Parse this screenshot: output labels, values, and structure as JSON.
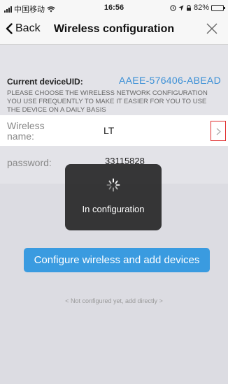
{
  "status_bar": {
    "carrier": "中国移动",
    "time": "16:56",
    "battery": "82%",
    "battery_level": 0.82
  },
  "nav": {
    "back_label": "Back",
    "title": "Wireless configuration"
  },
  "device": {
    "uid_label": "Current deviceUID:",
    "uid_value": "AAEE-576406-ABEAD",
    "description": "PLEASE CHOOSE THE WIRELESS NETWORK CONFIGURATION YOU USE FREQUENTLY TO MAKE IT EASIER FOR YOU TO USE THE DEVICE ON A DAILY BASIS"
  },
  "wireless": {
    "label": "Wireless name:",
    "value": "LT"
  },
  "password": {
    "label": "password:",
    "value": "33115828"
  },
  "toast": {
    "message": "In configuration"
  },
  "actions": {
    "primary_label": "Configure wireless and add devices",
    "secondary_label": "< Not configured yet, add directly >"
  },
  "colors": {
    "accent": "#3a9be0",
    "uid": "#3a8fd6",
    "highlight_border": "#e02b2b"
  }
}
